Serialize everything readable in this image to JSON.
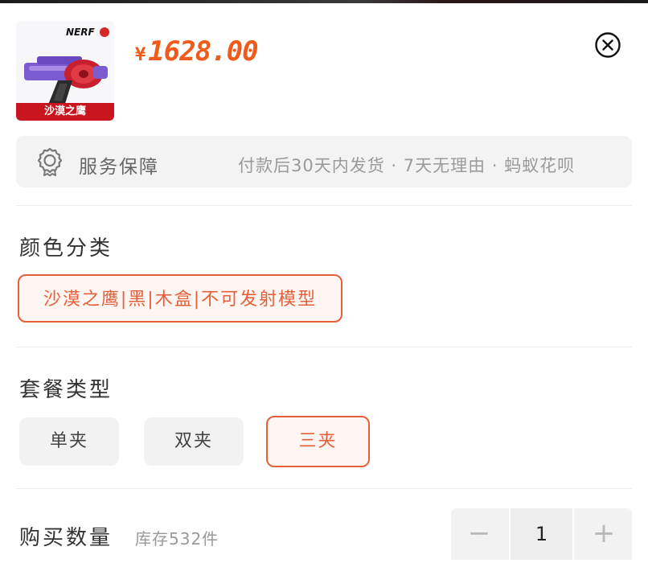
{
  "product": {
    "price": "1628.00",
    "currency": "¥",
    "thumb_brand": "NERF",
    "thumb_label": "沙漠之鹰"
  },
  "icons": {
    "close": "close-circle-icon",
    "service": "award-badge-icon",
    "minus": "minus-icon",
    "plus": "plus-icon"
  },
  "service": {
    "title": "服务保障",
    "description": "付款后30天内发货 · 7天无理由 · 蚂蚁花呗"
  },
  "color_section": {
    "title": "颜色分类",
    "options": [
      {
        "label": "沙漠之鹰|黑|木盒|不可发射模型",
        "selected": true
      }
    ]
  },
  "package_section": {
    "title": "套餐类型",
    "options": [
      {
        "label": "单夹",
        "selected": false
      },
      {
        "label": "双夹",
        "selected": false
      },
      {
        "label": "三夹",
        "selected": true
      }
    ]
  },
  "quantity": {
    "label": "购买数量",
    "stock": "库存532件",
    "value": "1",
    "minus": "−",
    "plus": "+"
  },
  "colors": {
    "accent": "#e4603a",
    "price": "#f05a1a",
    "thumb_label_bg": "#c8151e"
  }
}
